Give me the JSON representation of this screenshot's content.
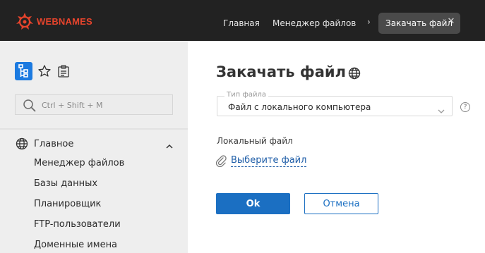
{
  "header": {
    "brand": "WEBNAMES",
    "nav": [
      "Главная",
      "Менеджер файлов"
    ],
    "active_tab": "Закачать файл",
    "colors": {
      "background": "#222222",
      "brand": "#e8442c",
      "active_tab": "#4a4a4a"
    }
  },
  "sidebar": {
    "tools": [
      {
        "icon": "tree-view-icon",
        "active": true
      },
      {
        "icon": "star-icon",
        "active": false
      },
      {
        "icon": "clipboard-icon",
        "active": false
      }
    ],
    "search": {
      "placeholder": "Ctrl + Shift + M",
      "icon": "search-icon"
    },
    "group": {
      "label": "Главное",
      "icon": "globe-icon",
      "expanded": true
    },
    "items": [
      "Менеджер файлов",
      "Базы данных",
      "Планировщик",
      "FTP-пользователи",
      "Доменные имена"
    ]
  },
  "main": {
    "title": "Закачать файл",
    "title_icon": "globe-icon",
    "file_type": {
      "legend": "Тип файла",
      "value": "Файл с локального компьютера",
      "help": "?"
    },
    "local_file": {
      "label": "Локальный файл",
      "link": "Выберите файл"
    },
    "buttons": {
      "ok": "Ok",
      "cancel": "Отмена"
    },
    "colors": {
      "primary": "#1b6fc2",
      "link": "#1f5ea8"
    }
  }
}
